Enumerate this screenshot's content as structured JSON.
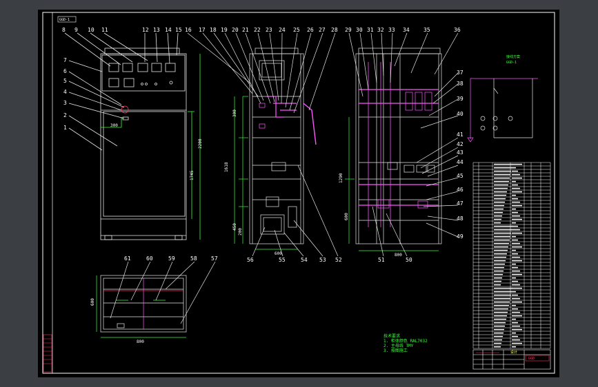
{
  "drawing": {
    "corner_tag": "GGD-1",
    "scheme_title": "GGD-1",
    "scheme_label": "接线方案",
    "front_callouts": [
      "8",
      "9",
      "10",
      "11",
      "12",
      "13",
      "14",
      "15",
      "7",
      "6",
      "5",
      "4",
      "3",
      "2",
      "1"
    ],
    "side_callouts_top": [
      "16",
      "17",
      "18",
      "19",
      "20",
      "21",
      "22",
      "23",
      "24",
      "25",
      "26",
      "27",
      "28"
    ],
    "rear_callouts_top": [
      "29",
      "30",
      "31",
      "32",
      "33",
      "34",
      "35",
      "36"
    ],
    "rear_callouts_right": [
      "37",
      "38",
      "39",
      "40",
      "41",
      "42",
      "43",
      "44",
      "45",
      "46",
      "47",
      "48",
      "49"
    ],
    "bottom_callouts_side": [
      "56",
      "55",
      "54",
      "53",
      "52"
    ],
    "bottom_callouts_rear": [
      "51",
      "50"
    ],
    "plan_callouts": [
      "61",
      "60",
      "59",
      "58",
      "57"
    ],
    "dimensions": {
      "height_total": "2200",
      "height_door": "1745",
      "panel_width": "800",
      "plan_width": "800",
      "plan_depth": "600",
      "side_1618": "1618",
      "side_1200": "1200",
      "rear_1290": "1290",
      "rear_600": "600",
      "rear_800": "800",
      "side_depth": "600",
      "front_dim_300": "300",
      "side_300": "300",
      "side_450": "450",
      "side_200": "200"
    },
    "title_block": {
      "stamp": "GGD",
      "signature_row": "设计"
    },
    "notes": [
      "技术要求",
      "1. 柜体颜色 RAL7032",
      "2. 主母线 TMY",
      "3. 按图施工"
    ],
    "colors": {
      "paper": "#000000",
      "frame": "#ffffff",
      "outline": "#e8e8e8",
      "bus": "#ff55ff",
      "accent": "#ff3366",
      "dimension": "#3cff3c",
      "table": "#ffffff",
      "notes": "#3cff3c",
      "background": "#3b3f44"
    }
  }
}
